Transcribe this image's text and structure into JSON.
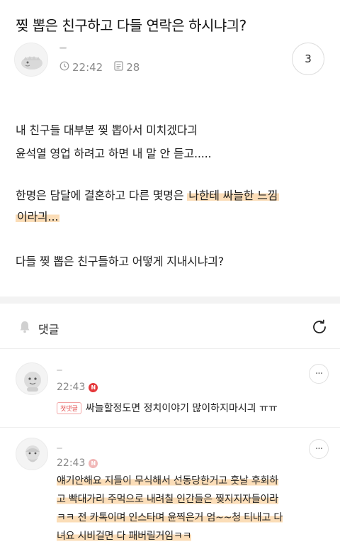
{
  "post": {
    "title": "찢 뽑은 친구하고 다들 연락은 하시냐긔?",
    "time": "22:42",
    "views": "28",
    "comment_count": "3",
    "body_lines": [
      "내 친구들 대부분 찢 뽑아서 미치겠다긔",
      "윤석열 영업 하려고 하면 내 말 안 듣고.....",
      "한명은 담달에 결혼하고 다른 몇명은 ",
      "나한테 싸늘한 느낌",
      "이라긔...",
      "다들 찢 뽑은 친구들하고 어떻게 지내시냐긔?"
    ]
  },
  "comments_section": {
    "label": "댓글"
  },
  "comments": [
    {
      "time": "22:43",
      "badge": "N",
      "first_label": "첫댓글",
      "text": "싸늘할정도면 정치이야기 많이하지마시긔 ㅠㅠ",
      "more": "···"
    },
    {
      "time": "22:43",
      "badge": "N",
      "more": "···",
      "lines": [
        "얘기안해요 지들이 무식해서 선동당한거고 훗날 후회하",
        "고 빡대가리 주먹으로 내려칠 인간들은 찢지지자들이라",
        "ㅋㅋ 전 카톡이며 인스타며 윤찍은거 엄~~청 티내고 다",
        "녀요 시비걸면 다 패버릴거임ㅋㅋ"
      ]
    }
  ],
  "icons": {
    "clock": "clock-icon",
    "views": "document-icon",
    "bell": "bell-icon",
    "refresh": "refresh-icon",
    "more": "more-icon"
  },
  "colors": {
    "highlight": "#fad2a0",
    "badge_red": "#e5383b",
    "meta_gray": "#8a8a8a"
  }
}
